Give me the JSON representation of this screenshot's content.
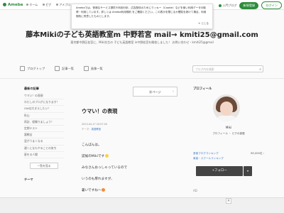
{
  "topbar": {
    "logo": "Ameba",
    "nav": [
      "ホーム",
      "ピグ",
      "アメブロ"
    ],
    "notice_label": "入門ブログ",
    "register_label": "新規登録",
    "login_label": "ログイン"
  },
  "cookie_notice": {
    "text": "Amebaでは、快適なサービス提供や利用分析、広告配信のためにクッキー（Cookie）などを使い利用データの取得・利用しています。詳しくは Ameba利用規約 をご確認ください。この表示を閉じるか閲覧を続けて場合、利用規約に同意したものとします。",
    "close_label": "とじる"
  },
  "blog": {
    "title": "藤本Mikiの子ども英語教室m 中野若宮 mail→ kmiti25@gmail.com",
    "subtitle": "東京都中野区若宮に、Miki先生の 子ども英語教室 in中野若宮を開校しました！ お問い合わせ・kmiti25@gmail"
  },
  "subnav": {
    "items": [
      "ブログトップ",
      "記事一覧",
      "画像一覧"
    ],
    "search_placeholder": "ブログ内を検索"
  },
  "sidebar": {
    "recent_heading": "最新の記事",
    "recent_items": [
      "ウマい！の表現",
      "わたしのブログになります！",
      "GWは大きえしたい！",
      "秋山",
      "再訪、経験りましょう！",
      "定期テスト",
      "悪戦苦",
      "翌がうまくなる",
      "遅くになもやることの気ち",
      "星をる人間"
    ],
    "more_label": "一覧を見る",
    "theme_heading": "テーマ"
  },
  "article": {
    "next_label": "次ページ",
    "title": "ウマい！の表現",
    "date": "2023-04-17 20:07:00",
    "theme_prefix": "テーマ：",
    "theme_link": "英語教室",
    "lines": [
      "こんばんは。",
      "認候のMikiです",
      "みなさんおっしゃっているので",
      "いうのも厚れますが、",
      "暑いですね〜"
    ]
  },
  "profile": {
    "heading": "プロフィール",
    "name": "Miki",
    "links": "プロフィール ・ ピグの部屋",
    "rank1_label": "音楽プログランキング",
    "rank1_value": "85,000位 ›",
    "rank2_label": "東高・スクールランキング",
    "follow_label": "+フォロー",
    "ad_label": "AD"
  },
  "ad_close_label": "×"
}
